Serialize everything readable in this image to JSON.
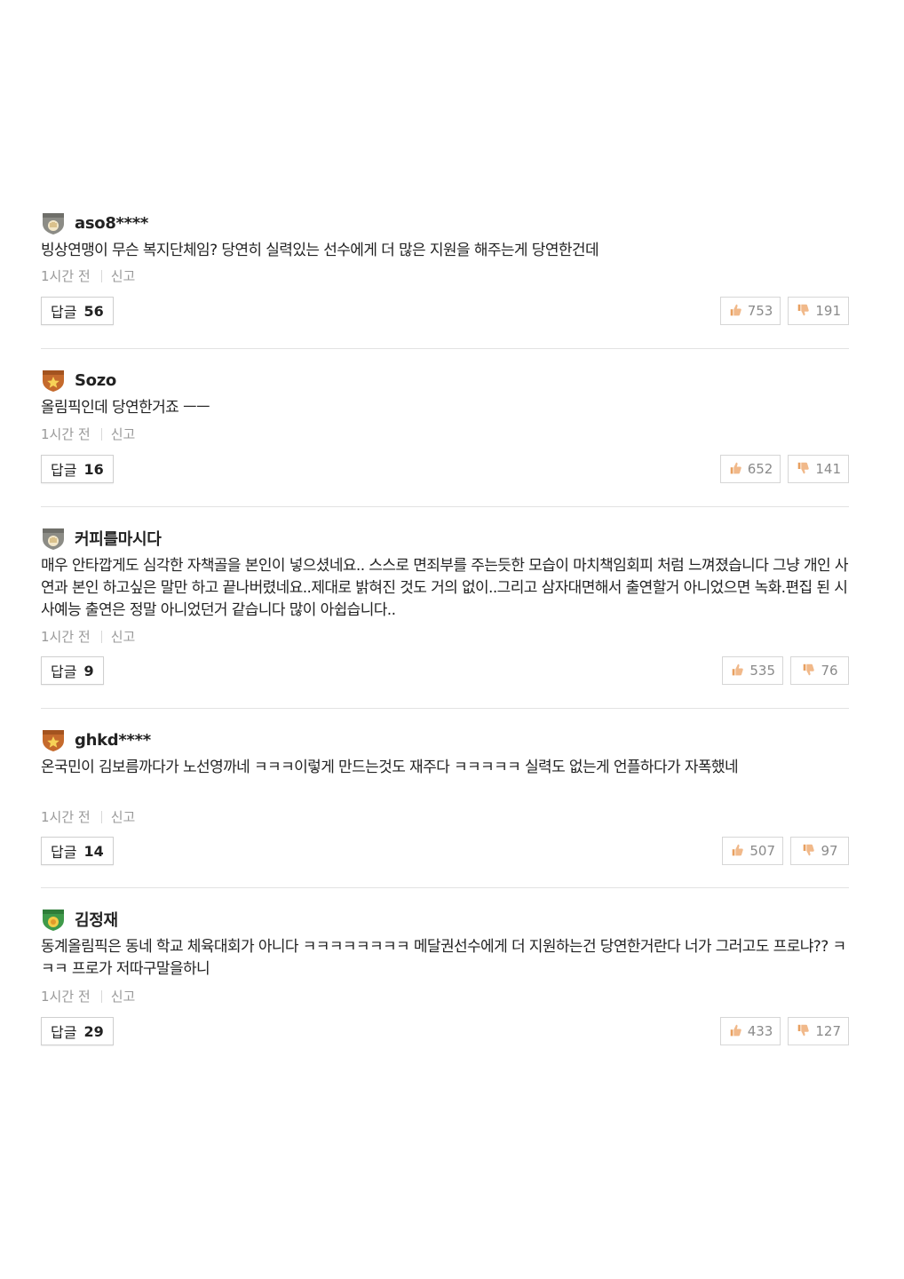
{
  "comments": [
    {
      "nickname": "aso8****",
      "badge_icon": "silver-hand-badge-icon",
      "text": "빙상연맹이 무슨 복지단체임? 당연히 실력있는 선수에게 더 많은 지원을 해주는게 당연한건데",
      "time": "1시간 전",
      "report_label": "신고",
      "reply_label": "답글",
      "reply_count": "56",
      "likes": "753",
      "dislikes": "191"
    },
    {
      "nickname": "Sozo",
      "badge_icon": "gold-star-badge-icon",
      "text": "올림픽인데 당연한거죠 ㅡㅡ",
      "time": "1시간 전",
      "report_label": "신고",
      "reply_label": "답글",
      "reply_count": "16",
      "likes": "652",
      "dislikes": "141"
    },
    {
      "nickname": "커피를마시다",
      "badge_icon": "silver-hand-badge-icon",
      "text": "매우 안타깝게도 심각한 자책골을 본인이 넣으셨네요.. 스스로 면죄부를 주는듯한 모습이 마치책임회피 처럼 느껴졌습니다 그냥 개인 사연과 본인 하고싶은 말만 하고 끝나버렸네요..제대로 밝혀진 것도 거의 없이..그리고 삼자대면해서 출연할거 아니었으면 녹화.편집 된 시사예능 출연은 정말 아니었던거 같습니다 많이 아쉽습니다..",
      "time": "1시간 전",
      "report_label": "신고",
      "reply_label": "답글",
      "reply_count": "9",
      "likes": "535",
      "dislikes": "76"
    },
    {
      "nickname": "ghkd****",
      "badge_icon": "gold-star-badge-icon",
      "text": "온국민이 김보름까다가 노선영까네 ㅋㅋㅋ이렇게 만드는것도 재주다 ㅋㅋㅋㅋㅋ 실력도 없는게 언플하다가 자폭했네",
      "time": "1시간 전",
      "report_label": "신고",
      "reply_label": "답글",
      "reply_count": "14",
      "likes": "507",
      "dislikes": "97"
    },
    {
      "nickname": "김정재",
      "badge_icon": "green-shield-badge-icon",
      "text": "동계올림픽은 동네 학교 체육대회가 아니다 ㅋㅋㅋㅋㅋㅋㅋㅋ 메달권선수에게 더 지원하는건 당연한거란다 너가 그러고도 프로냐?? ㅋㅋㅋ 프로가 저따구말을하니",
      "time": "1시간 전",
      "report_label": "신고",
      "reply_label": "답글",
      "reply_count": "29",
      "likes": "433",
      "dislikes": "127"
    }
  ],
  "colors": {
    "like_icon": "#e8a060",
    "badge_silver": "#8c8c86",
    "badge_gold": "#c56a2c",
    "badge_green": "#3f9a4a",
    "divider": "#e2e2e2"
  }
}
